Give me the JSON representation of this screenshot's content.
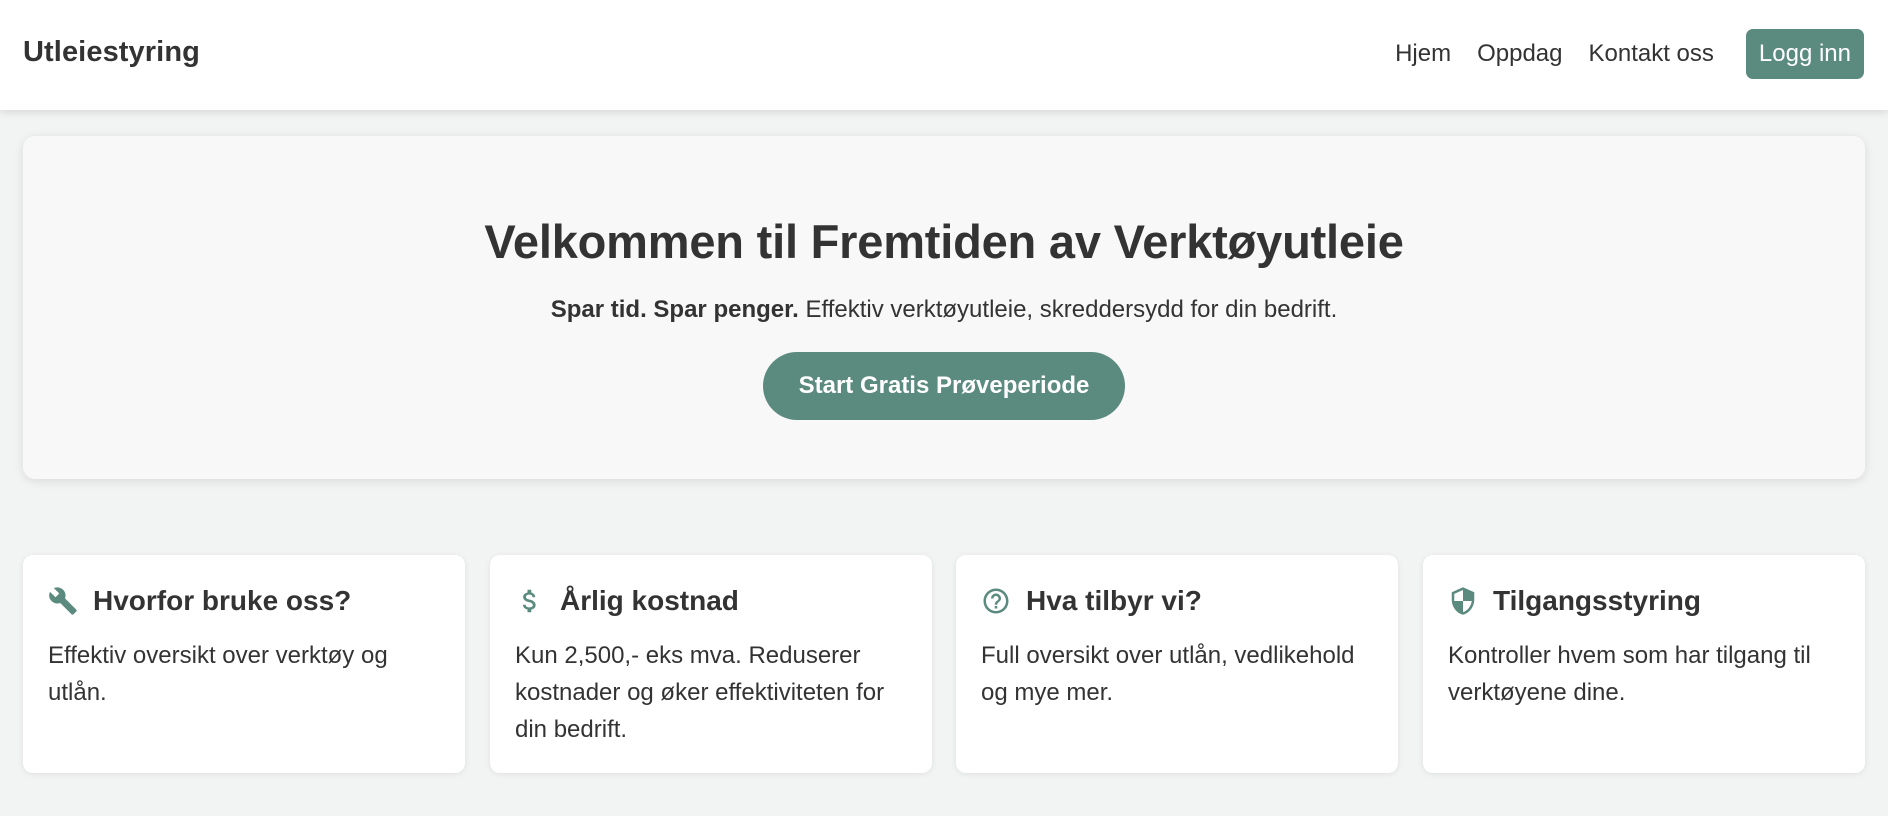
{
  "header": {
    "brand": "Utleiestyring",
    "nav": [
      {
        "label": "Hjem"
      },
      {
        "label": "Oppdag"
      },
      {
        "label": "Kontakt oss"
      }
    ],
    "login_label": "Logg inn"
  },
  "hero": {
    "title": "Velkommen til Fremtiden av Verktøyutleie",
    "subtitle_strong": "Spar tid. Spar penger.",
    "subtitle_rest": " Effektiv verktøyutleie, skreddersydd for din bedrift.",
    "cta_label": "Start Gratis Prøveperiode"
  },
  "features": [
    {
      "icon": "wrench-icon",
      "title": "Hvorfor bruke oss?",
      "text": "Effektiv oversikt over verktøy og utlån."
    },
    {
      "icon": "dollar-icon",
      "title": "Årlig kostnad",
      "text": "Kun 2,500,- eks mva. Reduserer kostnader og øker effektiviteten for din bedrift."
    },
    {
      "icon": "question-circle-icon",
      "title": "Hva tilbyr vi?",
      "text": "Full oversikt over utlån, vedlikehold og mye mer."
    },
    {
      "icon": "shield-icon",
      "title": "Tilgangsstyring",
      "text": "Kontroller hvem som har tilgang til verktøyene dine."
    }
  ],
  "colors": {
    "accent": "#5b8a7e",
    "page_background": "#f2f3f3",
    "text": "#333333"
  }
}
